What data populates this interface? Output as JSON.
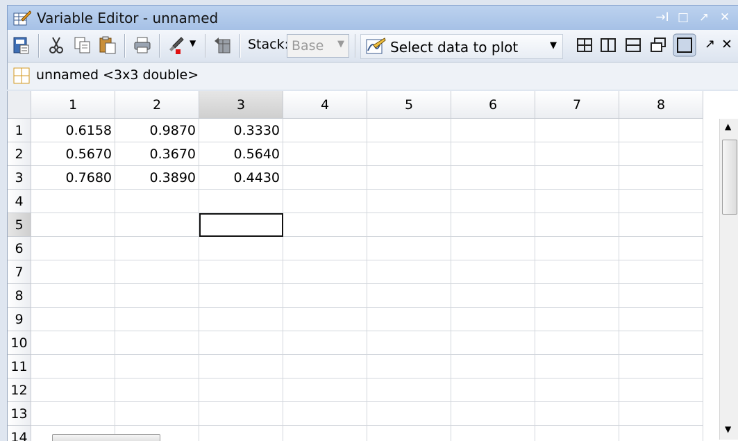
{
  "window": {
    "title": "Variable Editor - unnamed",
    "controls": [
      "→I",
      "□",
      "↗",
      "✕"
    ]
  },
  "toolbar": {
    "stack_label": "Stack:",
    "stack_value": "Base",
    "plot_label": "Select data to plot",
    "close_glyph": "✕",
    "undock_glyph": "↗"
  },
  "infobar": {
    "variable_label": "unnamed  <3x3 double>"
  },
  "grid": {
    "columns": [
      "1",
      "2",
      "3",
      "4",
      "5",
      "6",
      "7",
      "8"
    ],
    "rows": [
      "1",
      "2",
      "3",
      "4",
      "5",
      "6",
      "7",
      "8",
      "9",
      "10",
      "11",
      "12",
      "13",
      "14"
    ],
    "cells": [
      [
        "0.6158",
        "0.9870",
        "0.3330"
      ],
      [
        "0.5670",
        "0.3670",
        "0.5640"
      ],
      [
        "0.7680",
        "0.3890",
        "0.4430"
      ]
    ],
    "selected_row": "5",
    "selected_column": "3"
  },
  "colors": {
    "accent": "#a6c1e6",
    "selection_border": "#111111",
    "grid_line": "#d2d6dc"
  }
}
